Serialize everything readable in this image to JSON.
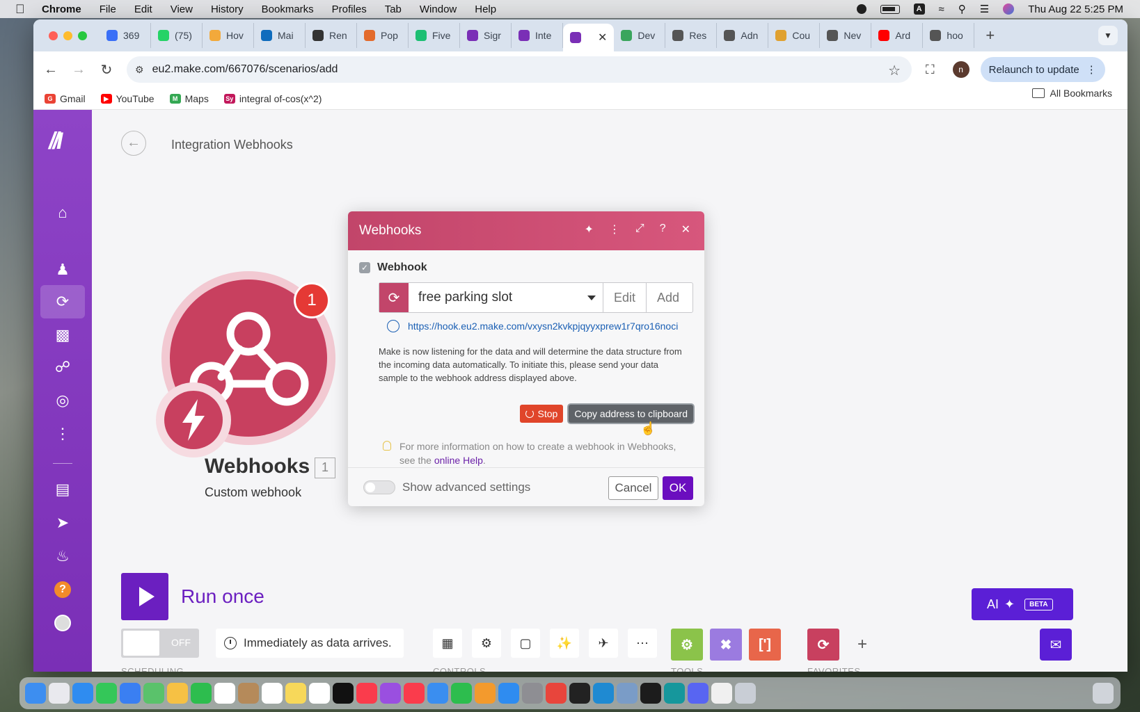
{
  "menubar": {
    "app": "Chrome",
    "items": [
      "File",
      "Edit",
      "View",
      "History",
      "Bookmarks",
      "Profiles",
      "Tab",
      "Window",
      "Help"
    ],
    "input_source": "A",
    "datetime": "Thu Aug 22  5:25 PM"
  },
  "tabs": [
    {
      "label": "369",
      "color": "#3a6ff7"
    },
    {
      "label": "(75)",
      "color": "#25d366"
    },
    {
      "label": "Hov",
      "color": "#f2a93b"
    },
    {
      "label": "Mai",
      "color": "#0f6cbd"
    },
    {
      "label": "Ren",
      "color": "#333333"
    },
    {
      "label": "Pop",
      "color": "#e36b2c"
    },
    {
      "label": "Five",
      "color": "#1dbf73"
    },
    {
      "label": "Sigr",
      "color": "#7a2fb6"
    },
    {
      "label": "Inte",
      "color": "#7a2fb6"
    },
    {
      "label": "",
      "color": "#7a2fb6",
      "active": true
    },
    {
      "label": "Dev",
      "color": "#3aa55d"
    },
    {
      "label": "Res",
      "color": "#555555"
    },
    {
      "label": "Adn",
      "color": "#555555"
    },
    {
      "label": "Cou",
      "color": "#e0a130"
    },
    {
      "label": "Nev",
      "color": "#555555"
    },
    {
      "label": "Ard",
      "color": "#ff0000"
    },
    {
      "label": "hoo",
      "color": "#555555"
    }
  ],
  "toolbar": {
    "url": "eu2.make.com/667076/scenarios/add",
    "profile_initial": "n",
    "relaunch_label": "Relaunch to update"
  },
  "bookmarks": {
    "items": [
      {
        "label": "Gmail",
        "color": "#ea4335"
      },
      {
        "label": "YouTube",
        "color": "#ff0000"
      },
      {
        "label": "Maps",
        "color": "#34a853"
      },
      {
        "label": "integral of-cos(x^2)",
        "color": "#c2185b"
      }
    ],
    "all_label": "All Bookmarks"
  },
  "scenario": {
    "title": "Integration Webhooks",
    "module_name": "Webhooks",
    "module_index": "1",
    "module_subtitle": "Custom webhook",
    "badge_count": "1"
  },
  "dialog": {
    "title": "Webhooks",
    "checkbox_label": "Webhook",
    "selected_hook": "free parking slot",
    "edit_label": "Edit",
    "add_label": "Add",
    "hook_url": "https://hook.eu2.make.com/vxysn2kvkpjqyyxprew1r7qro16noci",
    "info_text": "Make is now listening for the data and will determine the data structure from the incoming data automatically. To initiate this, please send your data sample to the webhook address displayed above.",
    "stop_label": "Stop",
    "copy_label": "Copy address to clipboard",
    "hint_text": "For more information on how to create a webhook in Webhooks, see the ",
    "hint_link": "online Help",
    "hint_end": ".",
    "advanced_label": "Show advanced settings",
    "cancel_label": "Cancel",
    "ok_label": "OK"
  },
  "bottom": {
    "run_label": "Run once",
    "toggle_label": "OFF",
    "schedule_text": "Immediately as data arrives.",
    "scheduling_label": "SCHEDULING",
    "controls_label": "CONTROLS",
    "tools_label": "TOOLS",
    "favorites_label": "FAVORITES",
    "ai_label": "AI",
    "ai_badge": "BETA"
  },
  "colors": {
    "brand_purple": "#6b1fc0",
    "webhook_red": "#c8405f",
    "stop_red": "#e0452a",
    "tools_green": "#8bc34a",
    "tools_purple": "#9b7be0",
    "tools_orange": "#e8664a"
  }
}
